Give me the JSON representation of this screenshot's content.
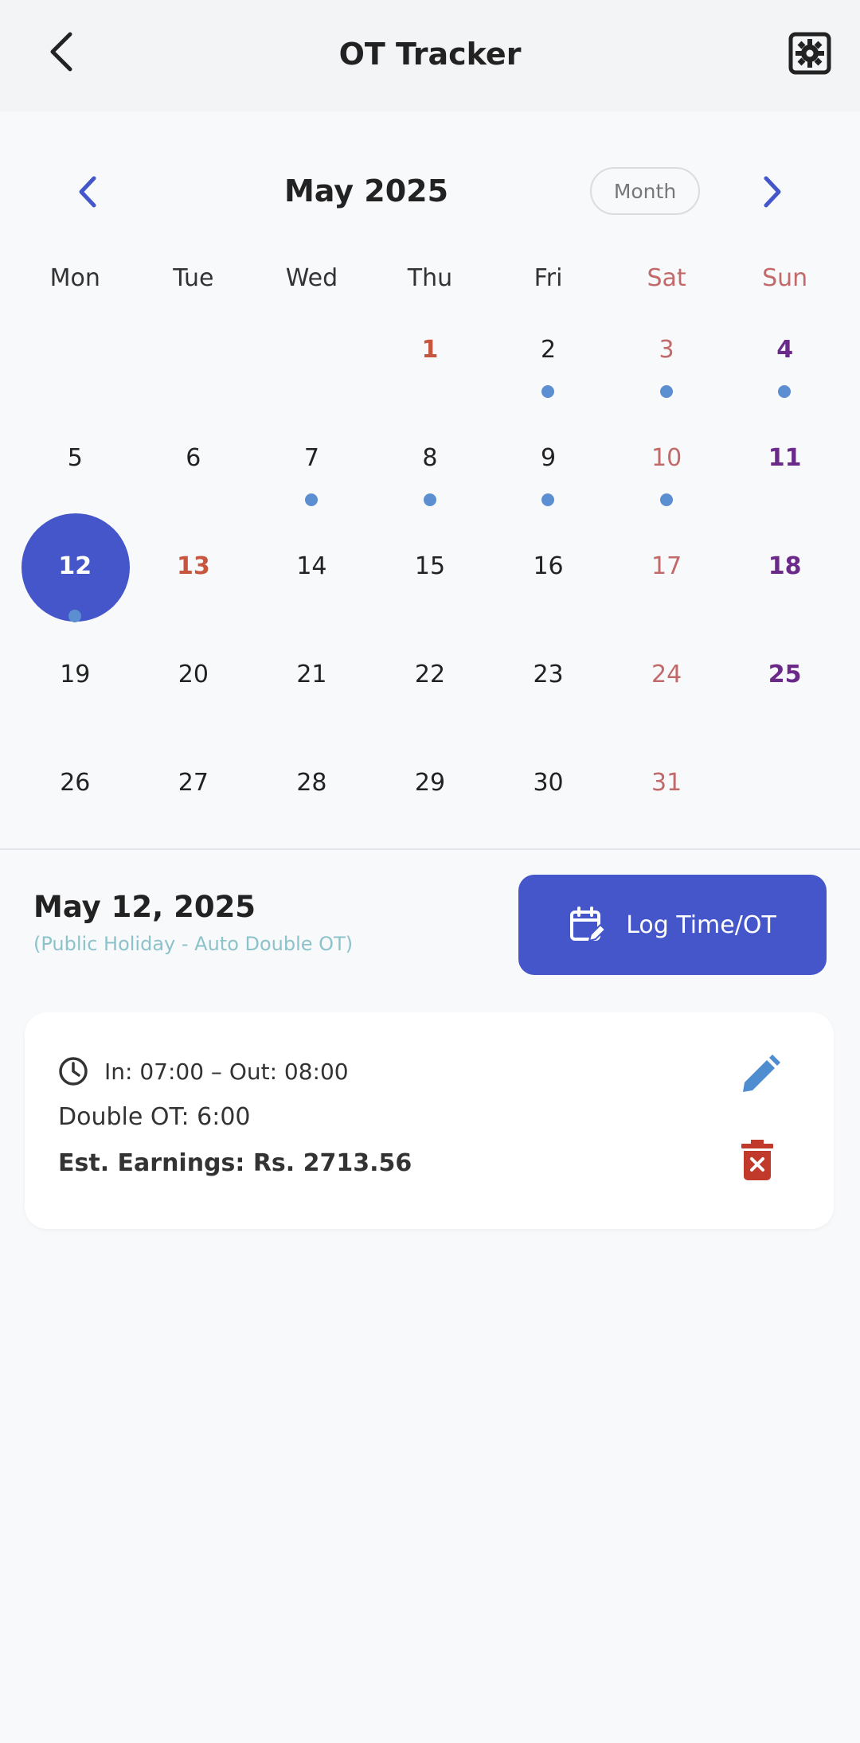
{
  "app_bar": {
    "title": "OT Tracker"
  },
  "calendar": {
    "month_title": "May 2025",
    "format_button": "Month",
    "weekdays": [
      "Mon",
      "Tue",
      "Wed",
      "Thu",
      "Fri",
      "Sat",
      "Sun"
    ],
    "weeks": [
      [
        "",
        "",
        "",
        "1",
        "2",
        "3",
        "4"
      ],
      [
        "5",
        "6",
        "7",
        "8",
        "9",
        "10",
        "11"
      ],
      [
        "12",
        "13",
        "14",
        "15",
        "16",
        "17",
        "18"
      ],
      [
        "19",
        "20",
        "21",
        "22",
        "23",
        "24",
        "25"
      ],
      [
        "26",
        "27",
        "28",
        "29",
        "30",
        "31",
        ""
      ]
    ],
    "selected_day": "12",
    "days_with_entries": [
      "2",
      "3",
      "4",
      "7",
      "8",
      "9",
      "10",
      "12"
    ],
    "holiday_days": [
      "1",
      "13"
    ],
    "colors": {
      "selected": "#4456c9",
      "holiday": "#c8553d",
      "saturday": "#c26a6a",
      "sunday": "#6b2a8a",
      "event_dot": "#5b8fd1"
    }
  },
  "day_detail": {
    "date": "May 12, 2025",
    "note": "(Public Holiday - Auto Double OT)",
    "log_button": "Log Time/OT"
  },
  "entry": {
    "time": "In: 07:00  –  Out: 08:00",
    "double_ot": "Double OT: 6:00",
    "earnings": "Est. Earnings: Rs. 2713.56"
  }
}
